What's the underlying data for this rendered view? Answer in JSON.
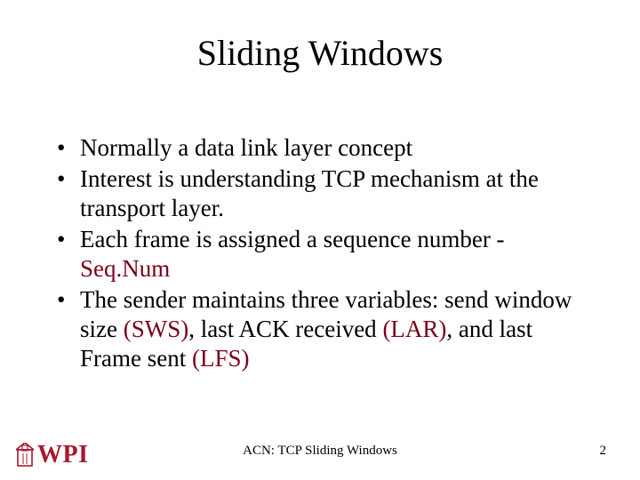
{
  "title": "Sliding Windows",
  "bullets": [
    {
      "pre": "Normally a data link layer concept",
      "term": "",
      "post": ""
    },
    {
      "pre": "Interest is understanding TCP mechanism at the transport layer.",
      "term": "",
      "post": ""
    },
    {
      "pre": "Each frame is assigned a sequence number - ",
      "term": "Seq.Num",
      "post": ""
    },
    {
      "pre": "The sender maintains three variables: send window size ",
      "term": "(SWS)",
      "mid": ", last ACK received ",
      "term2": "(LAR)",
      "mid2": ", and last Frame sent ",
      "term3": "(LFS)",
      "post": ""
    }
  ],
  "footer": {
    "center": "ACN: TCP Sliding Windows",
    "page": "2"
  },
  "logo": {
    "text": "WPI"
  }
}
